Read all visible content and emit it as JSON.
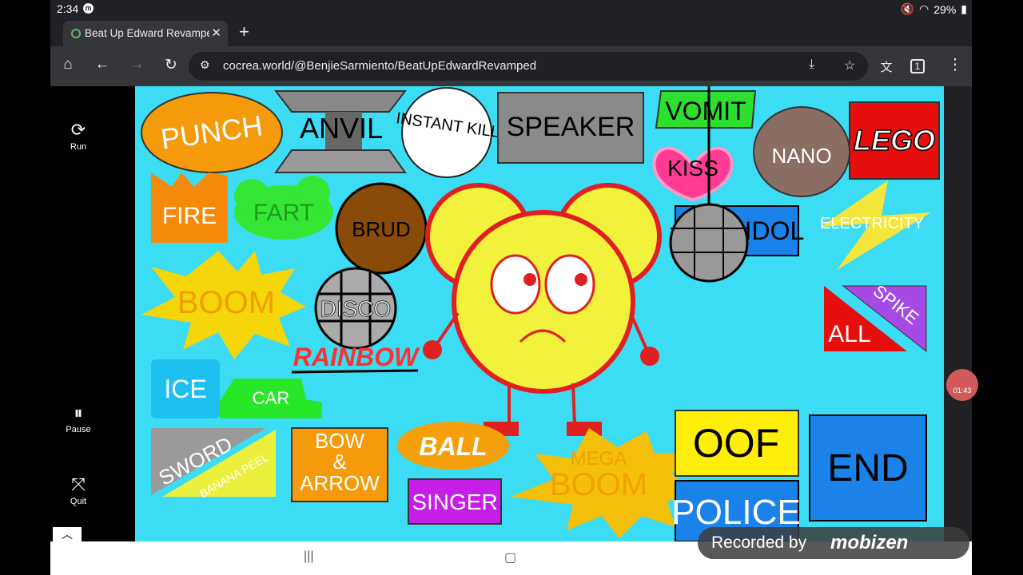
{
  "status": {
    "time": "2:34",
    "battery": "29%",
    "notif_badge": "m"
  },
  "browser": {
    "tab_title": "Beat Up Edward Revamped",
    "url": "cocrea.world/@BenjieSarmiento/BeatUpEdwardRevamped",
    "tab_count": "1"
  },
  "sidebar": {
    "run": "Run",
    "pause": "Pause",
    "quit": "Quit"
  },
  "game": {
    "punch": "PUNCH",
    "anvil": "ANVIL",
    "instant_kill": "INSTANT KILL",
    "speaker": "SPEAKER",
    "vomit": "VOMIT",
    "kiss": "KISS",
    "nano": "NANO",
    "lego": "LEGO",
    "fire": "FIRE",
    "fart": "FART",
    "brud": "BRUD",
    "idol": "IDOL",
    "electricity": "ELECTRICITY",
    "boom": "BOOM",
    "disco": "DISCO",
    "rainbow": "RAINBOW",
    "spike": "SPIKE",
    "all": "ALL",
    "ice": "ICE",
    "car": "CAR",
    "sword": "SWORD",
    "banana_peel": "BANANA PEEL",
    "bow_arrow_1": "BOW",
    "bow_arrow_2": "&",
    "bow_arrow_3": "ARROW",
    "ball": "BALL",
    "singer": "SINGER",
    "mega": "MEGA",
    "mega_boom": "BOOM",
    "oof": "OOF",
    "end": "END",
    "police": "POLICE"
  },
  "watermark": {
    "recorded_by": "Recorded by",
    "brand": "mobizen",
    "timer": "01:43"
  },
  "colors": {
    "game_bg": "#3cdcf4",
    "character_body": "#f2f23c",
    "character_outline": "#e02020"
  }
}
